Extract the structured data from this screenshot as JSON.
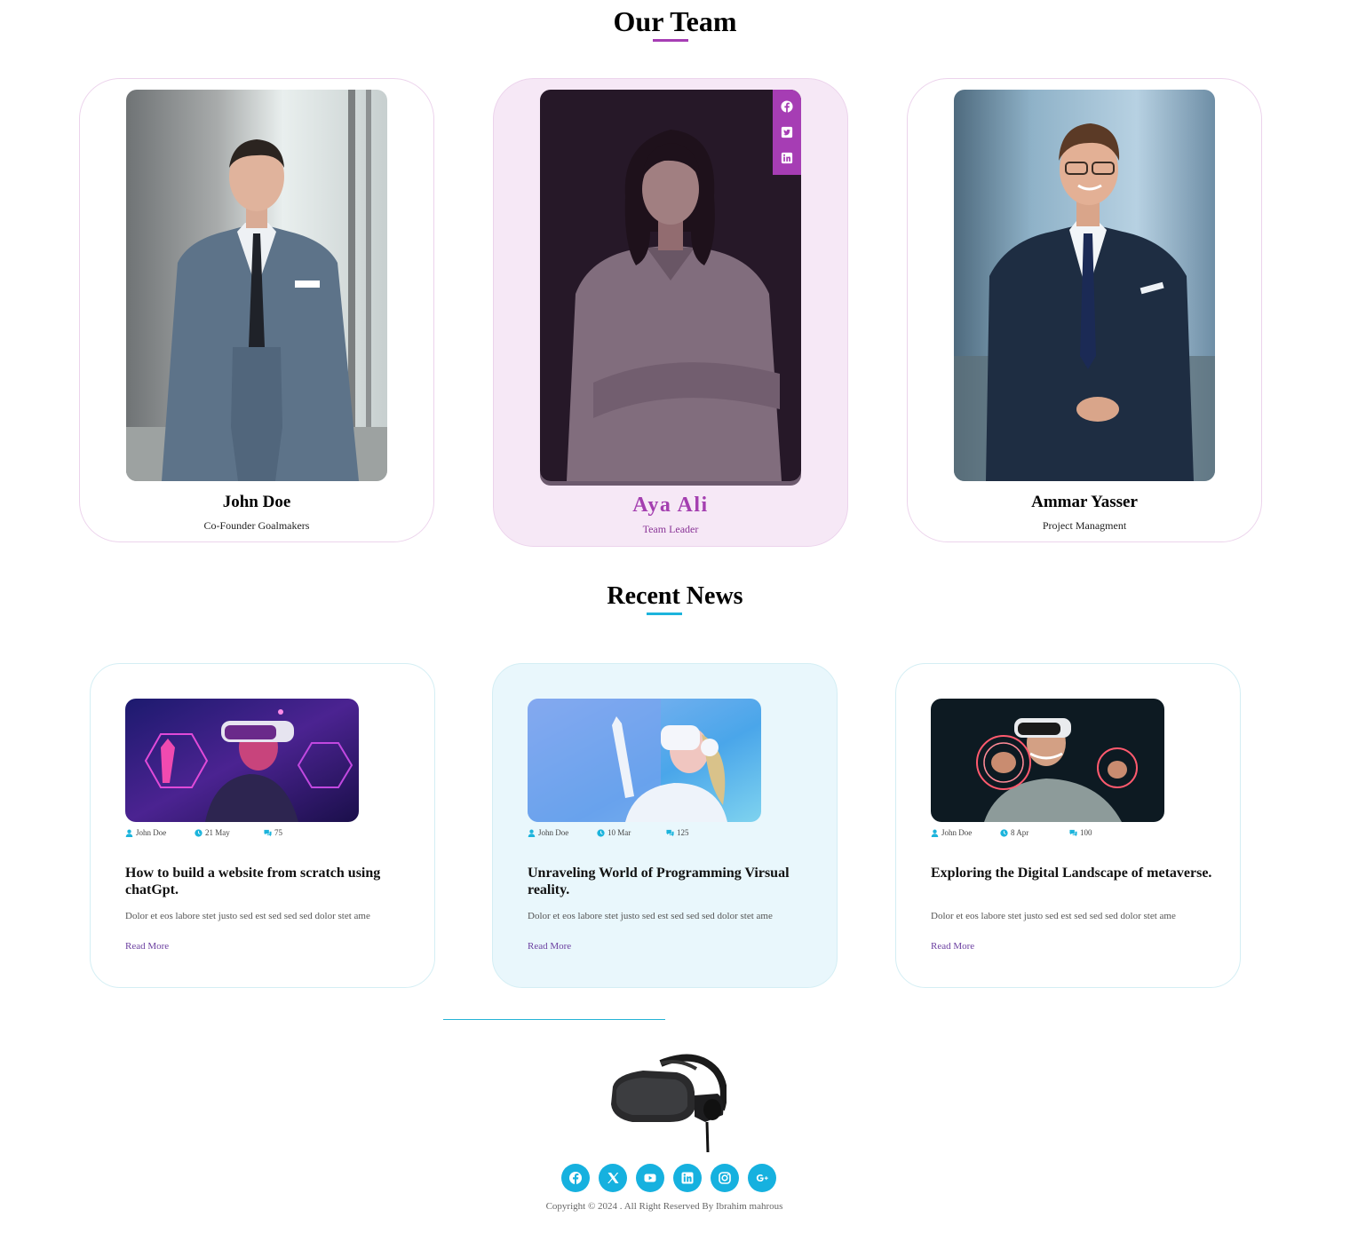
{
  "team": {
    "title": "Our Team",
    "accent": "#a63db4",
    "members": [
      {
        "name": "John Doe",
        "role": "Co-Founder Goalmakers"
      },
      {
        "name": "Aya Ali",
        "role": "Team Leader",
        "socials": [
          "facebook-icon",
          "twitter-icon",
          "linkedin-icon"
        ]
      },
      {
        "name": "Ammar Yasser",
        "role": "Project Managment"
      }
    ]
  },
  "news": {
    "title": "Recent News",
    "accent": "#1cb4dc",
    "read_more": "Read More",
    "posts": [
      {
        "author": "John Doe",
        "date": "21 May",
        "comments": "75",
        "title": "How to build a website from scratch using chatGpt.",
        "excerpt": "Dolor et eos labore stet justo sed est sed sed sed dolor stet ame"
      },
      {
        "author": "John Doe",
        "date": "10 Mar",
        "comments": "125",
        "title": "Unraveling World of Programming Virsual reality.",
        "excerpt": "Dolor et eos labore stet justo sed est sed sed sed dolor stet ame"
      },
      {
        "author": "John Doe",
        "date": "8 Apr",
        "comments": "100",
        "title": "Exploring the Digital Landscape of metaverse.",
        "excerpt": "Dolor et eos labore stet justo sed est sed sed sed dolor stet ame"
      }
    ]
  },
  "footer": {
    "socials": [
      "facebook-icon",
      "x-icon",
      "youtube-icon",
      "linkedin-icon",
      "instagram-icon",
      "google-plus-icon"
    ],
    "copyright": "Copyright © 2024 . All Right Reserved By Ibrahim mahrous"
  }
}
